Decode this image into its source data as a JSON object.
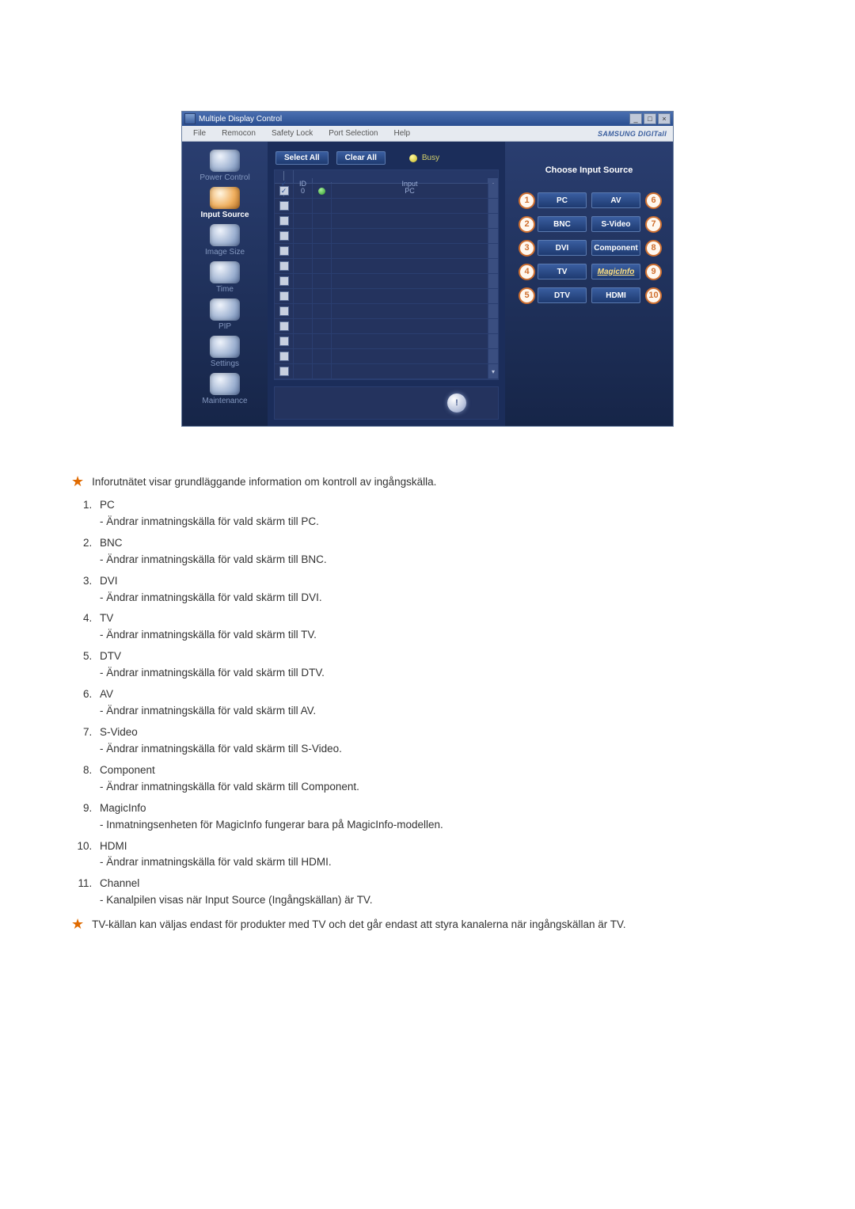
{
  "window": {
    "title": "Multiple Display Control",
    "brand": "SAMSUNG DIGITall"
  },
  "menubar": [
    "File",
    "Remocon",
    "Safety Lock",
    "Port Selection",
    "Help"
  ],
  "sidebar": [
    {
      "label": "Power Control",
      "active": false
    },
    {
      "label": "Input Source",
      "active": true
    },
    {
      "label": "Image Size",
      "active": false
    },
    {
      "label": "Time",
      "active": false
    },
    {
      "label": "PIP",
      "active": false
    },
    {
      "label": "Settings",
      "active": false
    },
    {
      "label": "Maintenance",
      "active": false
    }
  ],
  "toolbar": {
    "select_all": "Select All",
    "clear_all": "Clear All",
    "busy": "Busy"
  },
  "grid": {
    "headers": {
      "chk": "✓",
      "id": "ID",
      "status": "●",
      "input": "Input"
    },
    "data_row": {
      "id": "0",
      "input": "PC"
    },
    "extra_rows": 12
  },
  "right_panel": {
    "title": "Choose Input Source",
    "left": [
      {
        "n": "1",
        "label": "PC"
      },
      {
        "n": "2",
        "label": "BNC"
      },
      {
        "n": "3",
        "label": "DVI"
      },
      {
        "n": "4",
        "label": "TV"
      },
      {
        "n": "5",
        "label": "DTV"
      }
    ],
    "right": [
      {
        "n": "6",
        "label": "AV"
      },
      {
        "n": "7",
        "label": "S-Video"
      },
      {
        "n": "8",
        "label": "Component"
      },
      {
        "n": "9",
        "label": "MagicInfo",
        "magic": true
      },
      {
        "n": "10",
        "label": "HDMI"
      }
    ]
  },
  "doc": {
    "intro": "Inforutnätet visar grundläggande information om kontroll av ingångskälla.",
    "items": [
      {
        "title": "PC",
        "desc": "Ändrar inmatningskälla för vald skärm till PC."
      },
      {
        "title": "BNC",
        "desc": "Ändrar inmatningskälla för vald skärm till BNC."
      },
      {
        "title": "DVI",
        "desc": "Ändrar inmatningskälla för vald skärm till DVI."
      },
      {
        "title": "TV",
        "desc": "Ändrar inmatningskälla för vald skärm till TV."
      },
      {
        "title": "DTV",
        "desc": "Ändrar inmatningskälla för vald skärm till DTV."
      },
      {
        "title": "AV",
        "desc": "Ändrar inmatningskälla för vald skärm till AV."
      },
      {
        "title": "S-Video",
        "desc": "Ändrar inmatningskälla för vald skärm till S-Video."
      },
      {
        "title": "Component",
        "desc": "Ändrar inmatningskälla för vald skärm till Component."
      },
      {
        "title": "MagicInfo",
        "desc": "Inmatningsenheten för MagicInfo fungerar bara på MagicInfo-modellen."
      },
      {
        "title": "HDMI",
        "desc": "Ändrar inmatningskälla för vald skärm till HDMI."
      },
      {
        "title": "Channel",
        "desc": "Kanalpilen visas när Input Source (Ingångskällan) är TV."
      }
    ],
    "outro": "TV-källan kan väljas endast för produkter med TV och det går endast att styra kanalerna när ingångskällan är TV."
  }
}
